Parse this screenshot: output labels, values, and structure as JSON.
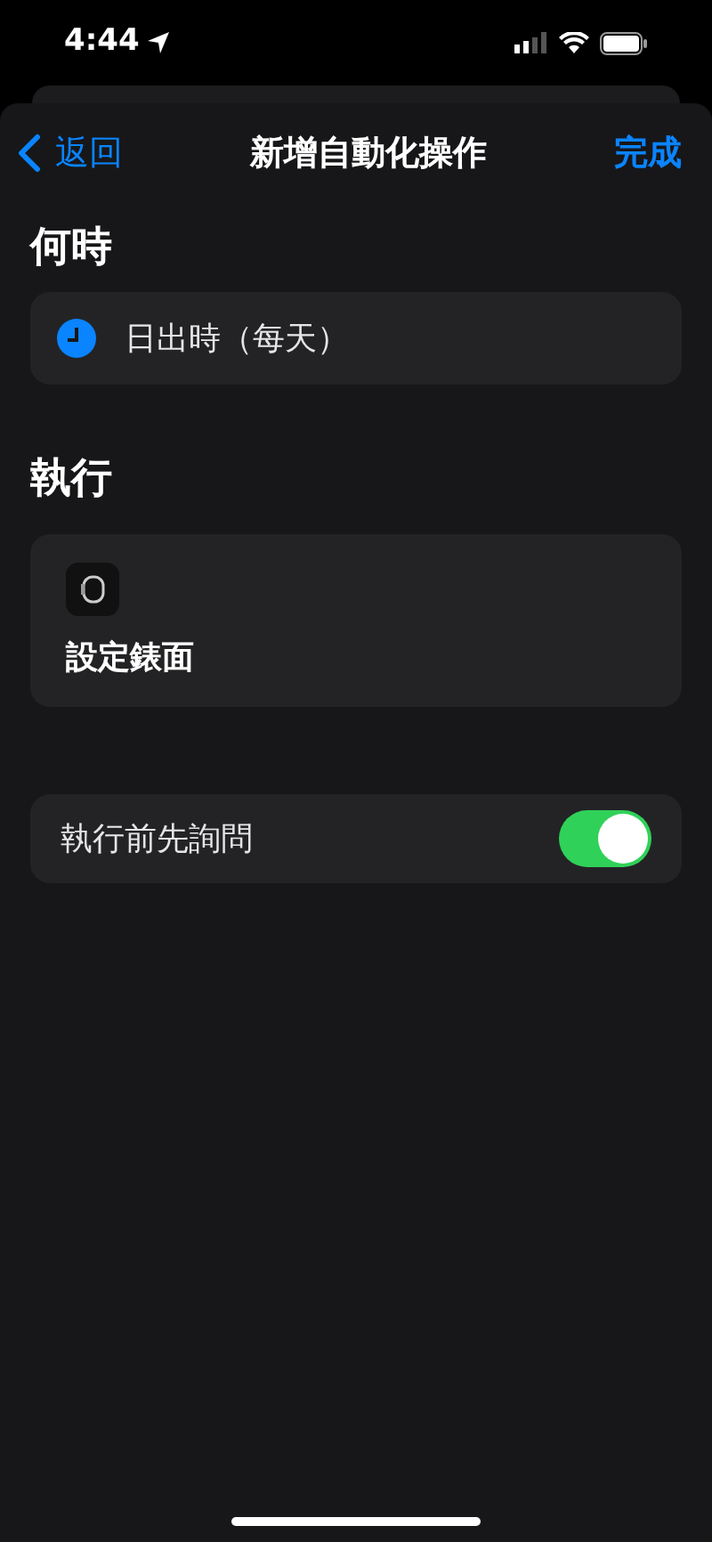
{
  "status_bar": {
    "time": "4:44"
  },
  "nav": {
    "back": "返回",
    "title": "新增自動化操作",
    "done": "完成"
  },
  "when": {
    "heading": "何時",
    "trigger": "日出時（每天）"
  },
  "do": {
    "heading": "執行",
    "action": "設定錶面"
  },
  "ask_before_running": {
    "label": "執行前先詢問",
    "on": true
  }
}
